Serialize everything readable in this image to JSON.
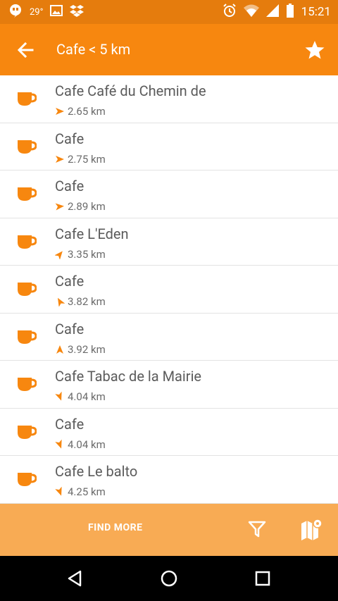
{
  "status_bar": {
    "temperature": "29°",
    "time": "15:21",
    "icons": [
      "hangouts-icon",
      "image-icon",
      "dropbox-icon",
      "alarm-icon",
      "wifi-icon",
      "signal-icon",
      "battery-icon"
    ]
  },
  "app_bar": {
    "title": "Cafe  < 5 km",
    "back_icon": "arrow-left-icon",
    "favorite_icon": "star-icon"
  },
  "colors": {
    "status_bar": "#e57c0d",
    "app_bar": "#f7870f",
    "accent": "#f7870f",
    "bottom_bar": "#f8ab54",
    "text_primary": "#5b5b5b",
    "text_secondary": "#6b6b6b"
  },
  "list": {
    "items": [
      {
        "name": "Cafe Café du Chemin de",
        "distance": "2.65 km",
        "bearing_deg": 90
      },
      {
        "name": "Cafe",
        "distance": "2.75 km",
        "bearing_deg": 90
      },
      {
        "name": "Cafe",
        "distance": "2.89 km",
        "bearing_deg": 85
      },
      {
        "name": "Cafe L'Eden",
        "distance": "3.35 km",
        "bearing_deg": 40
      },
      {
        "name": "Cafe",
        "distance": "3.82 km",
        "bearing_deg": 330
      },
      {
        "name": "Cafe",
        "distance": "3.92 km",
        "bearing_deg": 0
      },
      {
        "name": "Cafe Tabac de la Mairie",
        "distance": "4.04 km",
        "bearing_deg": 160
      },
      {
        "name": "Cafe",
        "distance": "4.04 km",
        "bearing_deg": 160
      },
      {
        "name": "Cafe Le balto",
        "distance": "4.25 km",
        "bearing_deg": 160
      }
    ]
  },
  "bottom_bar": {
    "find_more_label": "FIND MORE",
    "filter_icon": "filter-icon",
    "map_icon": "map-icon"
  },
  "nav_bar": {
    "icons": [
      "back-triangle-icon",
      "home-circle-icon",
      "recents-square-icon"
    ]
  }
}
